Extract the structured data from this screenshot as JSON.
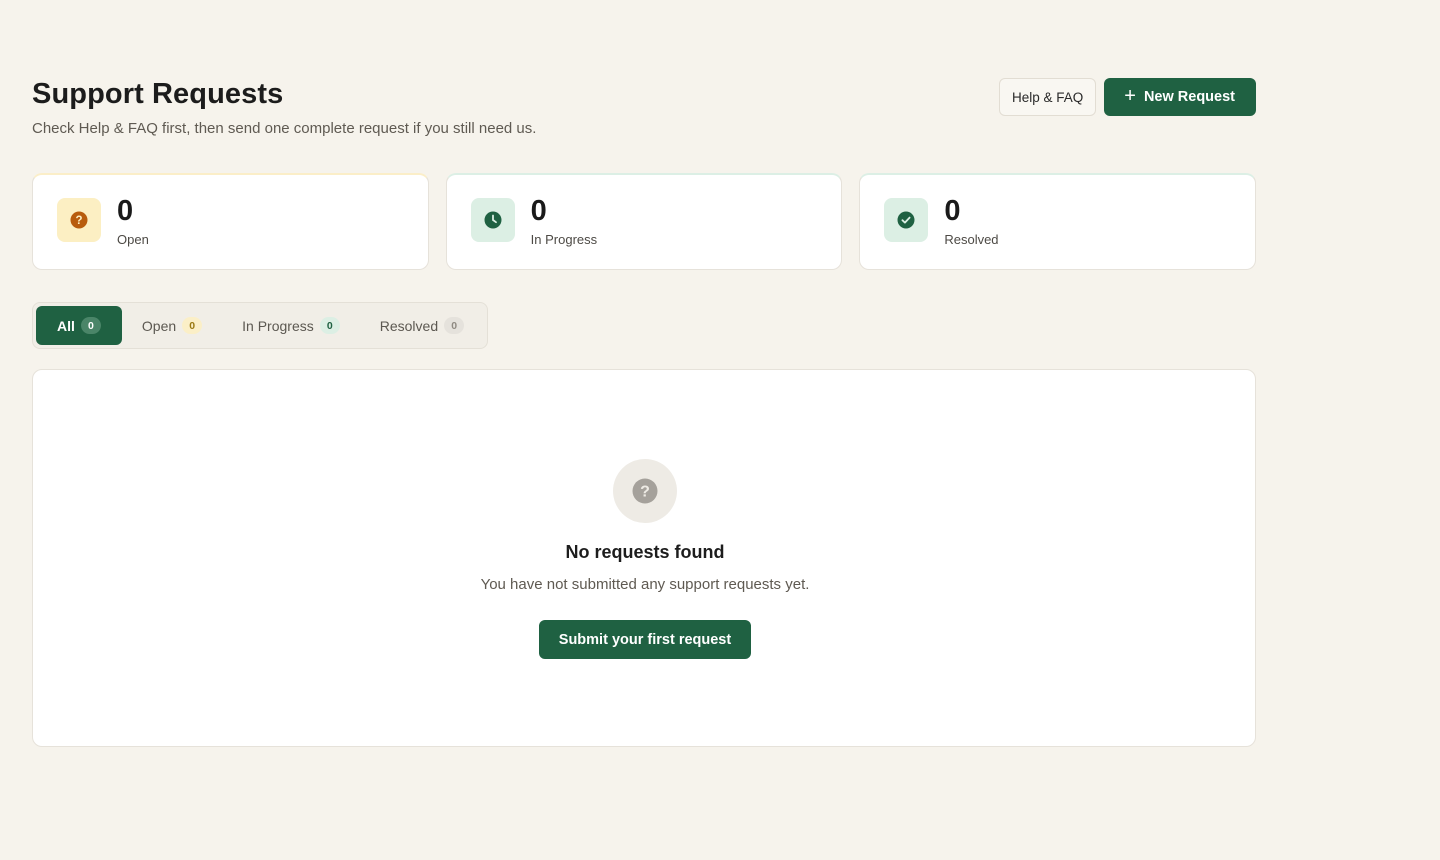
{
  "header": {
    "title": "Support Requests",
    "subtitle": "Check Help & FAQ first, then send one complete request if you still need us.",
    "help_label": "Help & FAQ",
    "new_request_label": "New Request"
  },
  "stats": [
    {
      "value": "0",
      "label": "Open",
      "icon": "question-icon"
    },
    {
      "value": "0",
      "label": "In Progress",
      "icon": "clock-icon"
    },
    {
      "value": "0",
      "label": "Resolved",
      "icon": "check-icon"
    }
  ],
  "tabs": [
    {
      "label": "All",
      "count": "0",
      "active": true
    },
    {
      "label": "Open",
      "count": "0"
    },
    {
      "label": "In Progress",
      "count": "0"
    },
    {
      "label": "Resolved",
      "count": "0"
    }
  ],
  "empty_state": {
    "icon": "question-icon",
    "title": "No requests found",
    "text": "You have not submitted any support requests yet.",
    "button_label": "Submit your first request"
  },
  "colors": {
    "primary": "#1f6142",
    "background": "#f6f3ec",
    "open_accent": "#fcefc3",
    "open_icon": "#b85c0d",
    "resolved_accent": "#dcefe4"
  }
}
